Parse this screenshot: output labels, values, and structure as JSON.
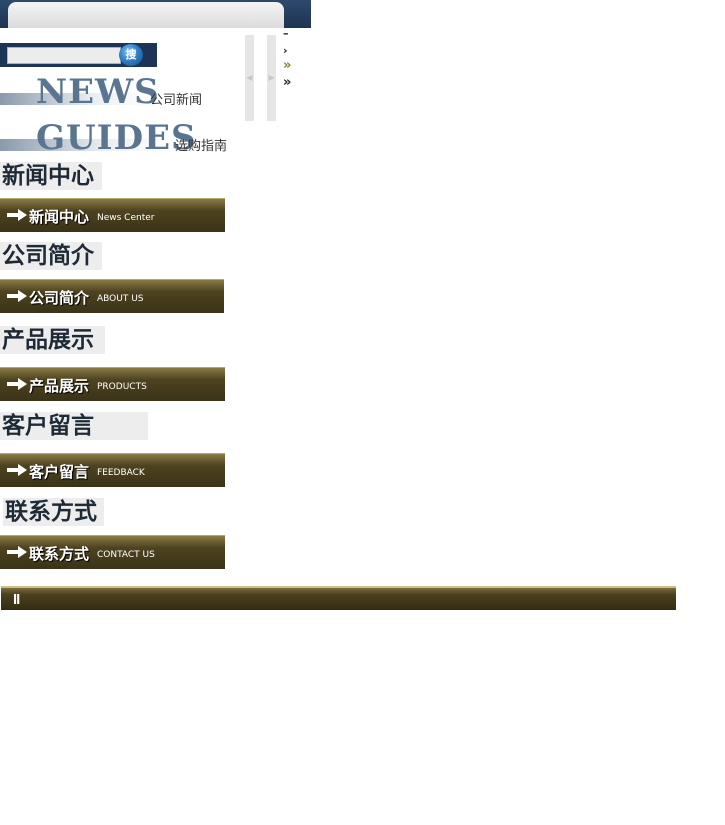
{
  "search": {
    "placeholder": "",
    "button_label": "搜"
  },
  "headings": [
    {
      "word": "NEWS",
      "sub": "公司新闻"
    },
    {
      "word": "GUIDES",
      "sub": "选购指南"
    }
  ],
  "side_links": [
    "–",
    "›",
    "»",
    "»"
  ],
  "sections": [
    {
      "title": "新闻中心",
      "bar_cn": "新闻中心",
      "bar_en": "News Center"
    },
    {
      "title": "公司简介",
      "bar_cn": "公司简介",
      "bar_en": "ABOUT US"
    },
    {
      "title": "产品展示",
      "bar_cn": "产品展示",
      "bar_en": "PRODUCTS"
    },
    {
      "title": "客户留言",
      "bar_cn": "客户留言",
      "bar_en": "FEEDBACK"
    },
    {
      "title": "联系方式",
      "bar_cn": "联系方式",
      "bar_en": "CONTACT US"
    }
  ],
  "footer": {
    "mark": "ǁ"
  }
}
